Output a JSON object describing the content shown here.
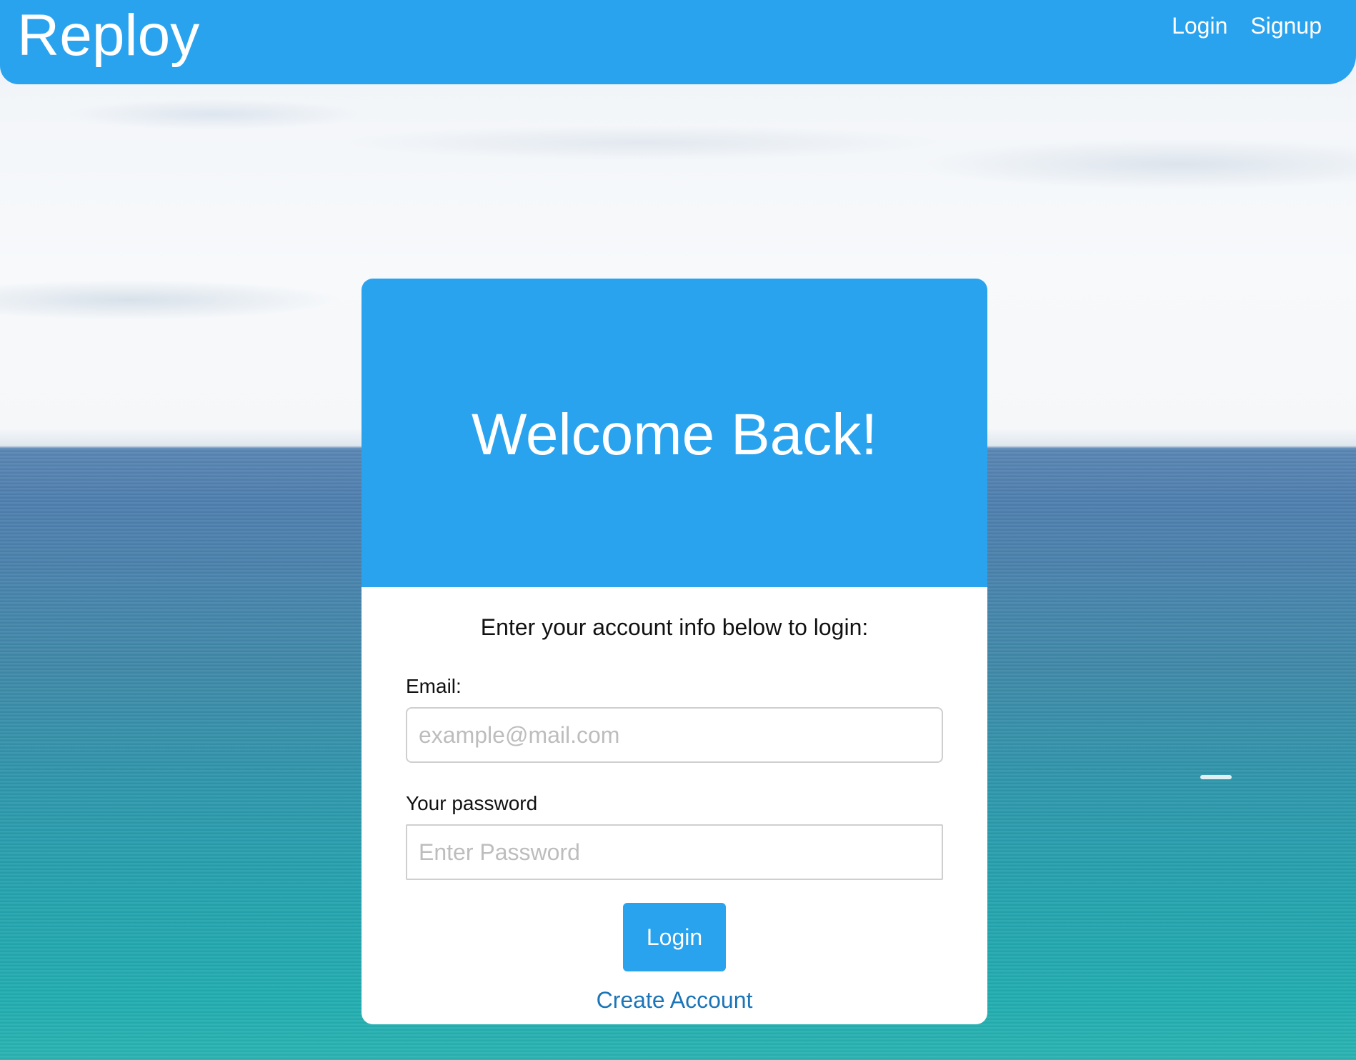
{
  "navbar": {
    "brand": "Reploy",
    "links": [
      {
        "label": "Login"
      },
      {
        "label": "Signup"
      }
    ]
  },
  "card": {
    "title": "Welcome Back!",
    "subtitle": "Enter your account info below to login:",
    "email": {
      "label": "Email:",
      "placeholder": "example@mail.com",
      "value": ""
    },
    "password": {
      "label": "Your password",
      "placeholder": "Enter Password",
      "value": ""
    },
    "login_button": "Login",
    "create_account_link": "Create Account"
  },
  "colors": {
    "primary": "#2aa3ef",
    "link": "#1b75b8"
  }
}
